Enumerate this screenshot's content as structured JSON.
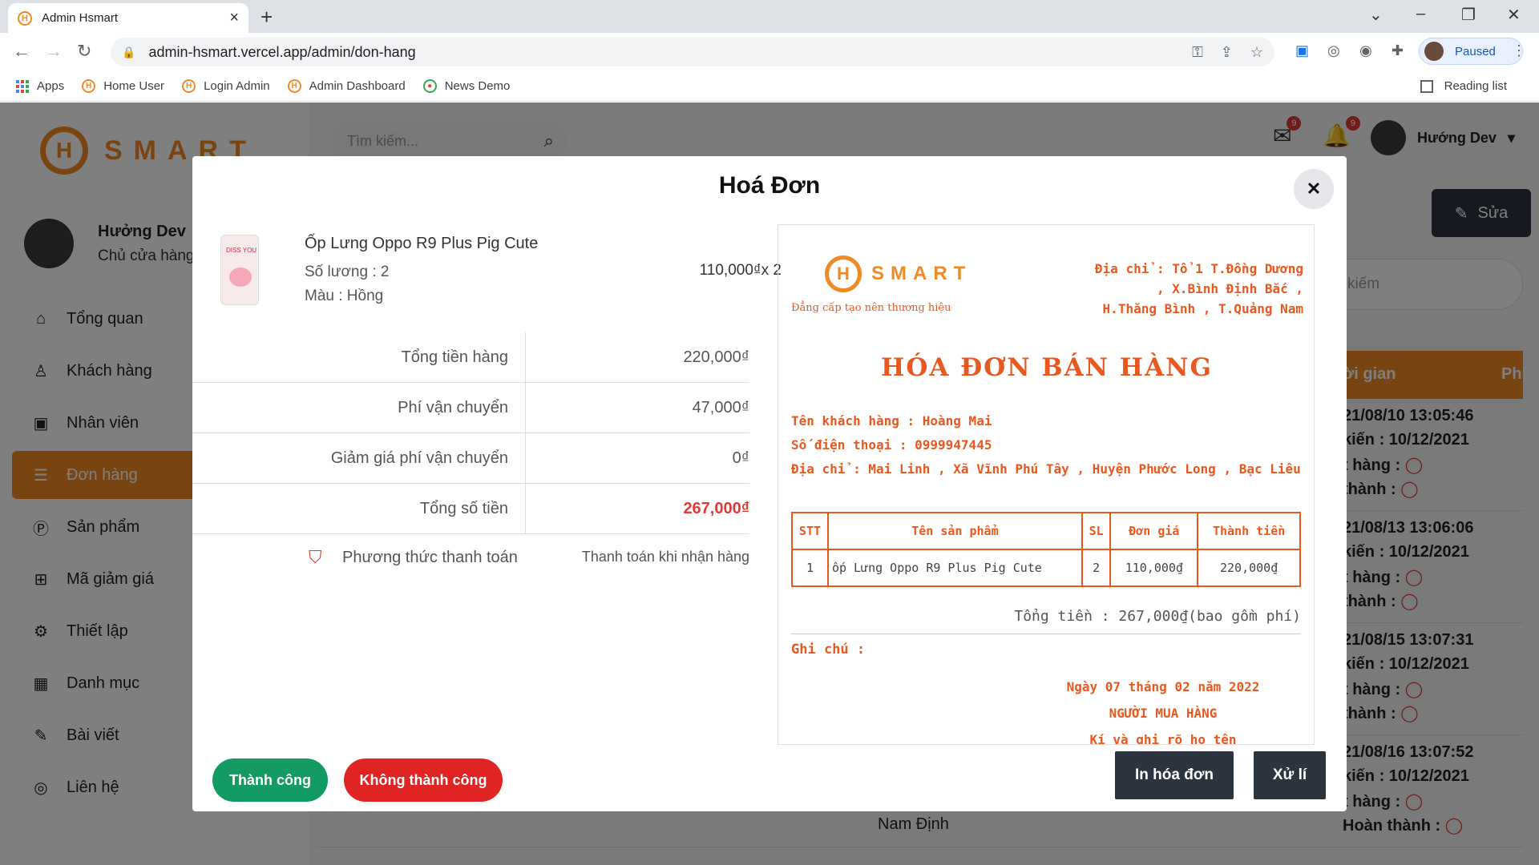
{
  "browser": {
    "tab_title": "Admin Hsmart",
    "url": "admin-hsmart.vercel.app/admin/don-hang",
    "profile_status": "Paused",
    "bookmarks": [
      "Apps",
      "Home User",
      "Login Admin",
      "Admin Dashboard",
      "News Demo"
    ],
    "reading_list": "Reading list"
  },
  "app": {
    "logo_text": "SMART",
    "logo_letter": "H",
    "search_placeholder": "Tìm kiếm...",
    "mail_badge": "9",
    "bell_badge": "9",
    "user_name": "Hướng Dev",
    "profile": {
      "name": "Hưởng Dev",
      "role": "Chủ cửa hàng"
    },
    "menu": [
      {
        "label": "Tổng quan",
        "icon": "home-icon"
      },
      {
        "label": "Khách hàng",
        "icon": "user-icon"
      },
      {
        "label": "Nhân viên",
        "icon": "badge-icon"
      },
      {
        "label": "Đơn hàng",
        "icon": "receipt-icon"
      },
      {
        "label": "Sản phẩm",
        "icon": "product-icon"
      },
      {
        "label": "Mã giảm giá",
        "icon": "gift-icon"
      },
      {
        "label": "Thiết lập",
        "icon": "gear-icon"
      },
      {
        "label": "Danh mục",
        "icon": "grid-icon"
      },
      {
        "label": "Bài viết",
        "icon": "pen-icon"
      },
      {
        "label": "Liên hệ",
        "icon": "contact-icon"
      }
    ],
    "active_menu": 3,
    "edit_button": "Sửa",
    "search2_placeholder": "kiếm",
    "table_headers": [
      "ời gian",
      "Phí"
    ],
    "rows": [
      {
        "time": "21/08/10 13:05:46",
        "expected": "kiến : 10/12/2021",
        "l1": "t hàng :",
        "l2": "thành :"
      },
      {
        "time": "21/08/13 13:06:06",
        "expected": "kiến : 10/12/2021",
        "l1": "t hàng :",
        "l2": "thành :"
      },
      {
        "time": "21/08/15 13:07:31",
        "expected": "kiến : 10/12/2021",
        "l1": "t hàng :",
        "l2": "thành :"
      },
      {
        "time": "21/08/16 13:07:52",
        "expected": "kiến : 10/12/2021",
        "l1": "t hàng :",
        "l2": "Hoàn thành :"
      }
    ],
    "bottom_city": "Nam Định"
  },
  "modal": {
    "title": "Hoá Đơn",
    "product": {
      "name": "Ốp Lưng Oppo R9 Plus Pig Cute",
      "qty": "Số lương : 2",
      "color": "Màu : Hồng",
      "price": "110,000₫x 2",
      "image_text": "DISS YOU"
    },
    "summary": [
      {
        "label": "Tổng tiền hàng",
        "value": "220,000₫"
      },
      {
        "label": "Phí vận chuyển",
        "value": "47,000₫"
      },
      {
        "label": "Giảm giá phí vận chuyển",
        "value": "0₫"
      },
      {
        "label": "Tổng số tiền",
        "value": "267,000₫"
      }
    ],
    "payment_label": "Phương thức thanh toán",
    "payment_value": "Thanh toán khi nhận hàng",
    "btn_success": "Thành công",
    "btn_fail": "Không thành công",
    "btn_print": "In hóa đơn",
    "btn_process": "Xử lí"
  },
  "invoice": {
    "slogan": "Đẳng cấp tạo nên thương hiệu",
    "address_lines": [
      "Địa chỉ : Tổ 1 T.Đồng Dương",
      ", X.Bình Định Bắc ,",
      "H.Thăng Bình , T.Quảng Nam"
    ],
    "title": "HÓA ĐƠN BÁN HÀNG",
    "customer": "Tên khách hàng : Hoàng Mai",
    "phone": "Số điện thoại : 0999947445",
    "address": "Địa chỉ : Mai Linh , Xã Vĩnh Phú Tây , Huyện Phước Long , Bạc Liêu",
    "table_headers": [
      "STT",
      "Tên sản phẩm",
      "SL",
      "Đơn giá",
      "Thành tiền"
    ],
    "table_rows": [
      [
        "1",
        "ốp Lưng Oppo R9 Plus Pig Cute",
        "2",
        "110,000₫",
        "220,000₫"
      ]
    ],
    "total": "Tổng tiền : 267,000₫(bao gồm phí)",
    "note": "Ghi chú :",
    "sign_lines": [
      "Ngày 07 tháng 02 năm 2022",
      "NGƯỜI MUA HÀNG",
      "Kí và ghi rõ họ tên"
    ]
  }
}
